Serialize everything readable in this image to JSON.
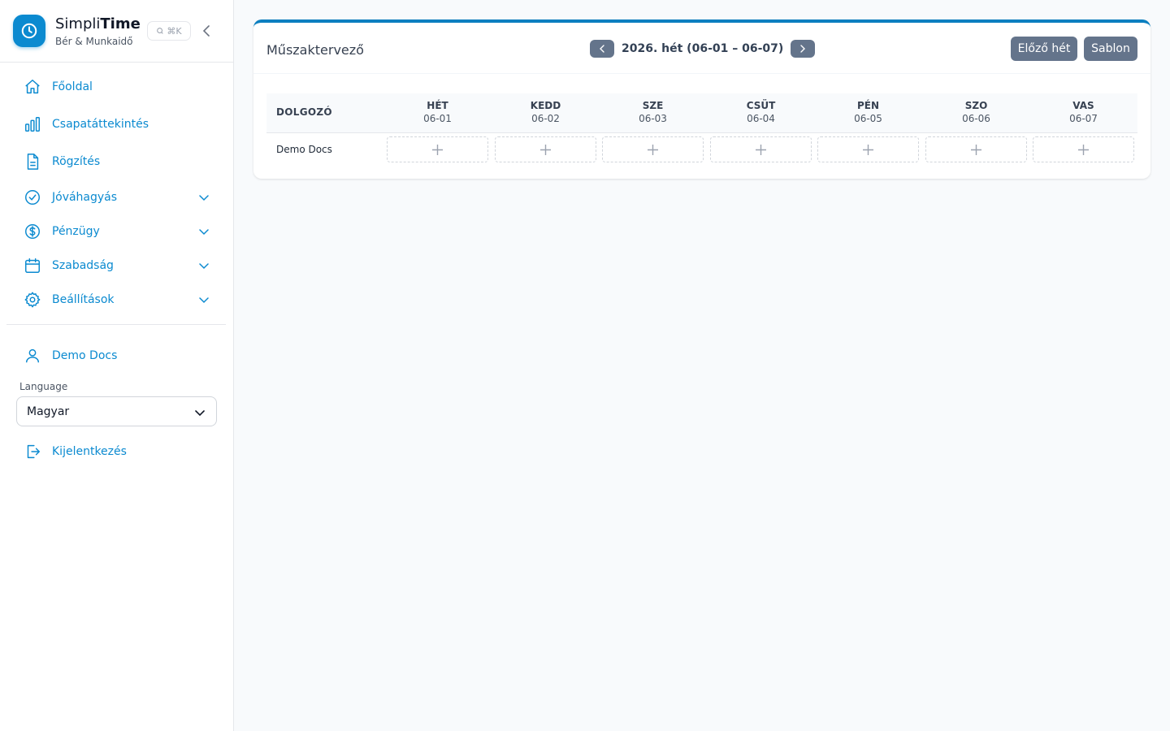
{
  "brand": {
    "name_part1": "Simpli",
    "name_part2": "Time",
    "subtitle": "Bér & Munkaidő",
    "shortcut": "⌘K"
  },
  "nav": {
    "home": "Főoldal",
    "team": "Csapatáttekintés",
    "record": "Rögzítés",
    "approval": "Jóváhagyás",
    "finance": "Pénzügy",
    "leave": "Szabadság",
    "settings": "Beállítások"
  },
  "user": {
    "name": "Demo Docs"
  },
  "language": {
    "label": "Language",
    "selected": "Magyar"
  },
  "logout": "Kijelentkezés",
  "planner": {
    "title": "Műszaktervező",
    "week_label": "2026. hét (06-01 – 06-07)",
    "prev_week_button": "Előző hét",
    "template_button": "Sablon",
    "employee_header": "DOLGOZÓ",
    "days": [
      {
        "name": "HÉT",
        "date": "06-01"
      },
      {
        "name": "KEDD",
        "date": "06-02"
      },
      {
        "name": "SZE",
        "date": "06-03"
      },
      {
        "name": "CSÜT",
        "date": "06-04"
      },
      {
        "name": "PÉN",
        "date": "06-05"
      },
      {
        "name": "SZO",
        "date": "06-06"
      },
      {
        "name": "VAS",
        "date": "06-07"
      }
    ],
    "rows": [
      {
        "employee": "Demo Docs"
      }
    ]
  },
  "colors": {
    "accent": "#0b8ad0",
    "button": "#64748b"
  }
}
